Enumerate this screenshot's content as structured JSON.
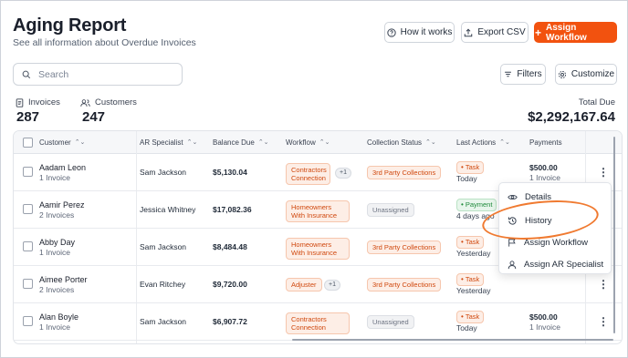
{
  "header": {
    "title": "Aging Report",
    "subtitle": "See all information about Overdue Invoices",
    "how_it_works": "How it works",
    "export_csv": "Export CSV",
    "assign_workflow": "Assign Workflow"
  },
  "toolbar": {
    "search_placeholder": "Search",
    "filters": "Filters",
    "customize": "Customize"
  },
  "stats": {
    "invoices_label": "Invoices",
    "invoices_value": "287",
    "customers_label": "Customers",
    "customers_value": "247",
    "total_label": "Total Due",
    "total_value": "$2,292,167.64"
  },
  "table": {
    "columns": [
      "Customer",
      "AR Specialist",
      "Balance Due",
      "Workflow",
      "Collection Status",
      "Last Actions",
      "Payments"
    ],
    "rows": [
      {
        "name": "Aadam Leon",
        "invoices": "1 Invoice",
        "specialist": "Sam Jackson",
        "balance": "$5,130.04",
        "workflow": "Contractors Connection",
        "workflow_extra": "+1",
        "status": "3rd Party Collections",
        "action": "Task",
        "action_when": "Today",
        "payment": "$500.00",
        "payment_inv": "1 Invoice"
      },
      {
        "name": "Aamir Perez",
        "invoices": "2 Invoices",
        "specialist": "Jessica Whitney",
        "balance": "$17,082.36",
        "workflow": "Homeowners With Insurance",
        "workflow_extra": "",
        "status": "Unassigned",
        "action": "Payment",
        "action_when": "4 days ago",
        "payment": "",
        "payment_inv": ""
      },
      {
        "name": "Abby Day",
        "invoices": "1 Invoice",
        "specialist": "Sam Jackson",
        "balance": "$8,484.48",
        "workflow": "Homeowners With Insurance",
        "workflow_extra": "",
        "status": "3rd Party Collections",
        "action": "Task",
        "action_when": "Yesterday",
        "payment": "",
        "payment_inv": ""
      },
      {
        "name": "Aimee Porter",
        "invoices": "2 Invoices",
        "specialist": "Evan Ritchey",
        "balance": "$9,720.00",
        "workflow": "Adjuster",
        "workflow_extra": "+1",
        "status": "3rd Party Collections",
        "action": "Task",
        "action_when": "Yesterday",
        "payment": "",
        "payment_inv": ""
      },
      {
        "name": "Alan Boyle",
        "invoices": "1 Invoice",
        "specialist": "Sam Jackson",
        "balance": "$6,907.72",
        "workflow": "Contractors Connection",
        "workflow_extra": "",
        "status": "Unassigned",
        "action": "Task",
        "action_when": "Today",
        "payment": "$500.00",
        "payment_inv": "1 Invoice"
      }
    ]
  },
  "context_menu": {
    "items": [
      "Details",
      "History",
      "Assign Workflow",
      "Assign AR Specialist"
    ]
  },
  "colors": {
    "accent": "#f2520f",
    "highlight": "#f07a30"
  }
}
